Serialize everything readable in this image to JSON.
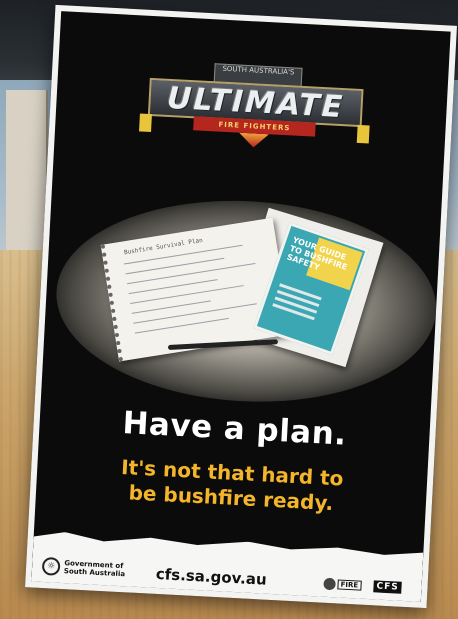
{
  "logo": {
    "top_text": "SOUTH AUSTRALIA'S",
    "title": "ULTIMATE",
    "subtitle": "FIRE FIGHTERS"
  },
  "notebook": {
    "title": "Bushfire Survival Plan"
  },
  "brochure": {
    "title": "YOUR GUIDE TO BUSHFIRE SAFETY"
  },
  "headline": "Have a plan.",
  "subline_1": "It's not that hard to",
  "subline_2": "be bushfire ready.",
  "footer": {
    "gov_line1": "Government of",
    "gov_line2": "South Australia",
    "url": "cfs.sa.gov.au",
    "fire_label": "FIRE",
    "cfs_label": "CFS"
  },
  "colors": {
    "poster_bg": "#0b0b0b",
    "headline": "#ffffff",
    "subline": "#f4b52a",
    "brochure": "#3aa7b2"
  }
}
